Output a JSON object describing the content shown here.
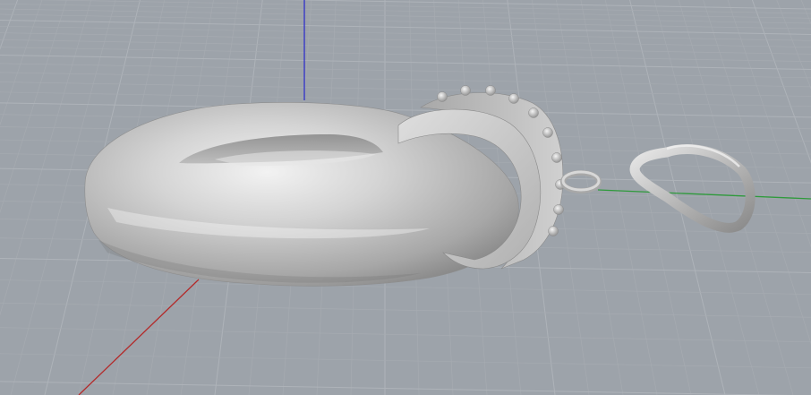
{
  "viewport": {
    "projection": "perspective",
    "display_mode": "shaded",
    "background_color": "#9da3aa",
    "grid": {
      "visible": true,
      "major_line_color": "#aeb3b9",
      "minor_line_color": "#a6abb1"
    },
    "axes": {
      "x_color": "#b32a2a",
      "y_color": "#2f9a3c",
      "z_color": "#3030c8"
    },
    "objects": [
      {
        "name": "torus",
        "material_color": "#bdbdbd"
      },
      {
        "name": "wheel",
        "material_color": "#c4c4c4"
      },
      {
        "name": "small-eye-ring",
        "material_color": "#bdbdbd"
      },
      {
        "name": "teardrop-thimble",
        "material_color": "#bdbdbd"
      }
    ]
  }
}
